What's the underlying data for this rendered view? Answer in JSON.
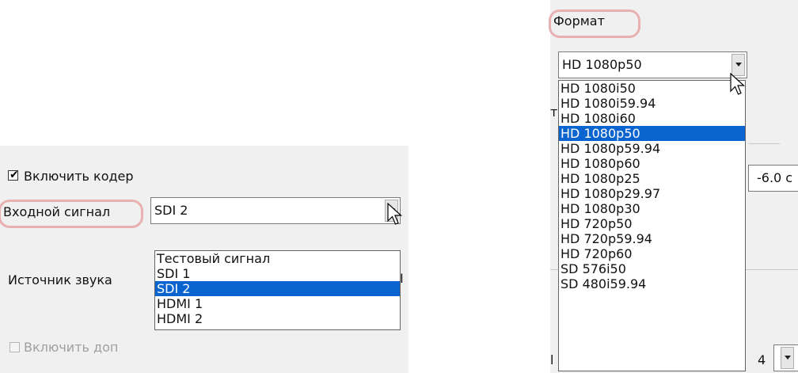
{
  "left": {
    "enable_encoder_label": "Включить кодер",
    "input_signal_label": "Входной сигнал",
    "input_signal_value": "SDI 2",
    "audio_source_label": "Источник звука",
    "audio_source_partial": "I",
    "enable_extra_partial": "Включить доп",
    "dropdown_items": [
      "Тестовый сигнал",
      "SDI 1",
      "SDI 2",
      "HDMI 1",
      "HDMI 2"
    ],
    "selected_index": 2
  },
  "right": {
    "format_label": "Формат",
    "format_value": "HD 1080p50",
    "partial_left_top": "та",
    "partial_db": "-6.0 c",
    "partial_left_bottom": "l",
    "partial_bottom_mid": "4",
    "dropdown_items": [
      "HD 1080i50",
      "HD 1080i59.94",
      "HD 1080i60",
      "HD 1080p50",
      "HD 1080p59.94",
      "HD 1080p60",
      "HD 1080p25",
      "HD 1080p29.97",
      "HD 1080p30",
      "HD 720p50",
      "HD 720p59.94",
      "HD 720p60",
      "SD 576i50",
      "SD 480i59.94"
    ],
    "selected_index": 3
  },
  "colors": {
    "selection": "#0a64d0",
    "highlight_ring": "#e8b0b0",
    "panel_bg": "#f0f0f0"
  }
}
